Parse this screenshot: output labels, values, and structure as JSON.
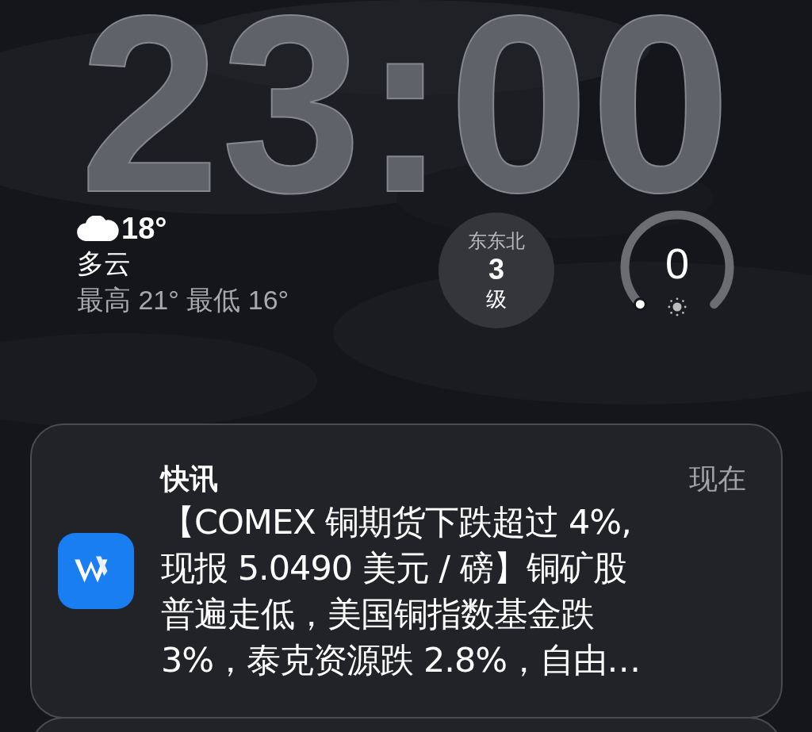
{
  "clock": {
    "time": "23:00"
  },
  "weather": {
    "temperature": "18°",
    "condition": "多云",
    "range": "最高 21° 最低 16°"
  },
  "wind": {
    "direction": "东东北",
    "force": "3",
    "unit": "级"
  },
  "uv_index": {
    "value": "0"
  },
  "notifications": [
    {
      "app": "快讯",
      "time": "现在",
      "body_lines": [
        "【COMEX 铜期货下跌超过 4%,",
        "现报 5.0490 美元 / 磅】铜矿股",
        "普遍走低，美国铜指数基金跌",
        " 3%，泰克资源跌 2.8%，自由…"
      ]
    }
  ]
}
